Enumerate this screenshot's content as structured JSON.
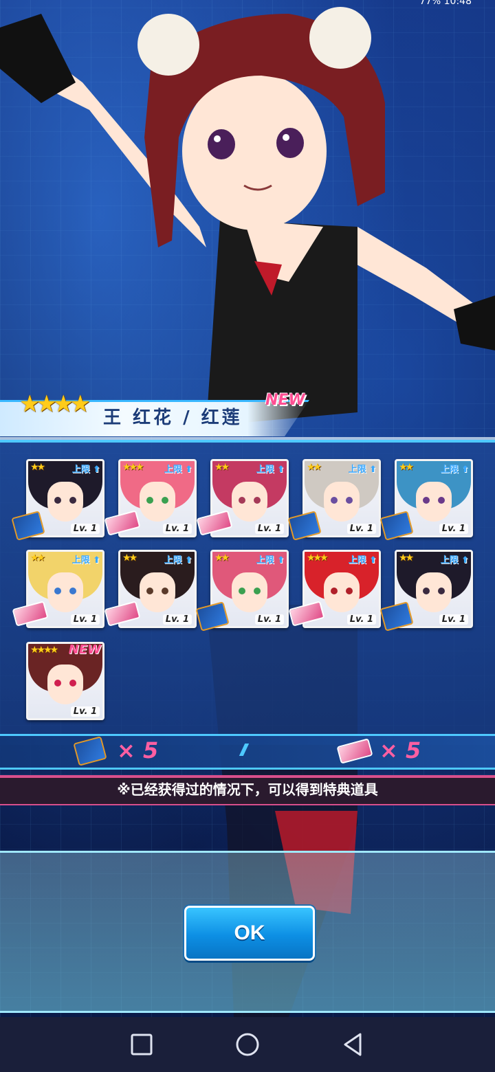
{
  "status_bar": {
    "right_text": "77% 10:48"
  },
  "character": {
    "rarity_stars": "★★★★",
    "name": "王 红花 / 红莲",
    "new_label": "NEW"
  },
  "cards": [
    {
      "stars": "★★",
      "limit": "上限",
      "lv": "Lv. 1",
      "hair": "#1e1a2a",
      "eye": "#3a2a40",
      "item": "book"
    },
    {
      "stars": "★★★",
      "limit": "上限",
      "lv": "Lv. 1",
      "hair": "#f06a86",
      "eye": "#3aa050",
      "item": "ticket"
    },
    {
      "stars": "★★",
      "limit": "上限",
      "lv": "Lv. 1",
      "hair": "#c43a62",
      "eye": "#a53a58",
      "item": "ticket"
    },
    {
      "stars": "★★",
      "limit": "上限",
      "lv": "Lv. 1",
      "hair": "#cfc9c2",
      "eye": "#6a4ea0",
      "item": "book"
    },
    {
      "stars": "★★",
      "limit": "上限",
      "lv": "Lv. 1",
      "hair": "#3d93c5",
      "eye": "#6a3a8a",
      "item": "book"
    },
    {
      "stars": "★★",
      "limit": "上限",
      "lv": "Lv. 1",
      "hair": "#f2d36a",
      "eye": "#3a78d0",
      "item": "ticket"
    },
    {
      "stars": "★★",
      "limit": "上限",
      "lv": "Lv. 1",
      "hair": "#2a1c1e",
      "eye": "#5a3a2a",
      "item": "ticket"
    },
    {
      "stars": "★★",
      "limit": "上限",
      "lv": "Lv. 1",
      "hair": "#e0587a",
      "eye": "#3aa050",
      "item": "book"
    },
    {
      "stars": "★★★",
      "limit": "上限",
      "lv": "Lv. 1",
      "hair": "#d8222a",
      "eye": "#b0202a",
      "item": "ticket"
    },
    {
      "stars": "★★",
      "limit": "上限",
      "lv": "Lv. 1",
      "hair": "#1e1a2a",
      "eye": "#3a2a40",
      "item": "book"
    },
    {
      "stars": "★★★★",
      "limit": "NEW",
      "lv": "Lv. 1",
      "hair": "#6a2424",
      "eye": "#d02050",
      "item": "none"
    }
  ],
  "counts": {
    "book": "× 5",
    "ticket": "× 5"
  },
  "notice": "※已经获得过的情况下，可以得到特典道具",
  "ok_button": "OK",
  "colors": {
    "accent": "#4ec9ff",
    "pink": "#ff5fa2",
    "ok_blue": "#0d8fe4"
  },
  "nav": {
    "icons": [
      "square-icon",
      "circle-icon",
      "triangle-back-icon"
    ]
  }
}
